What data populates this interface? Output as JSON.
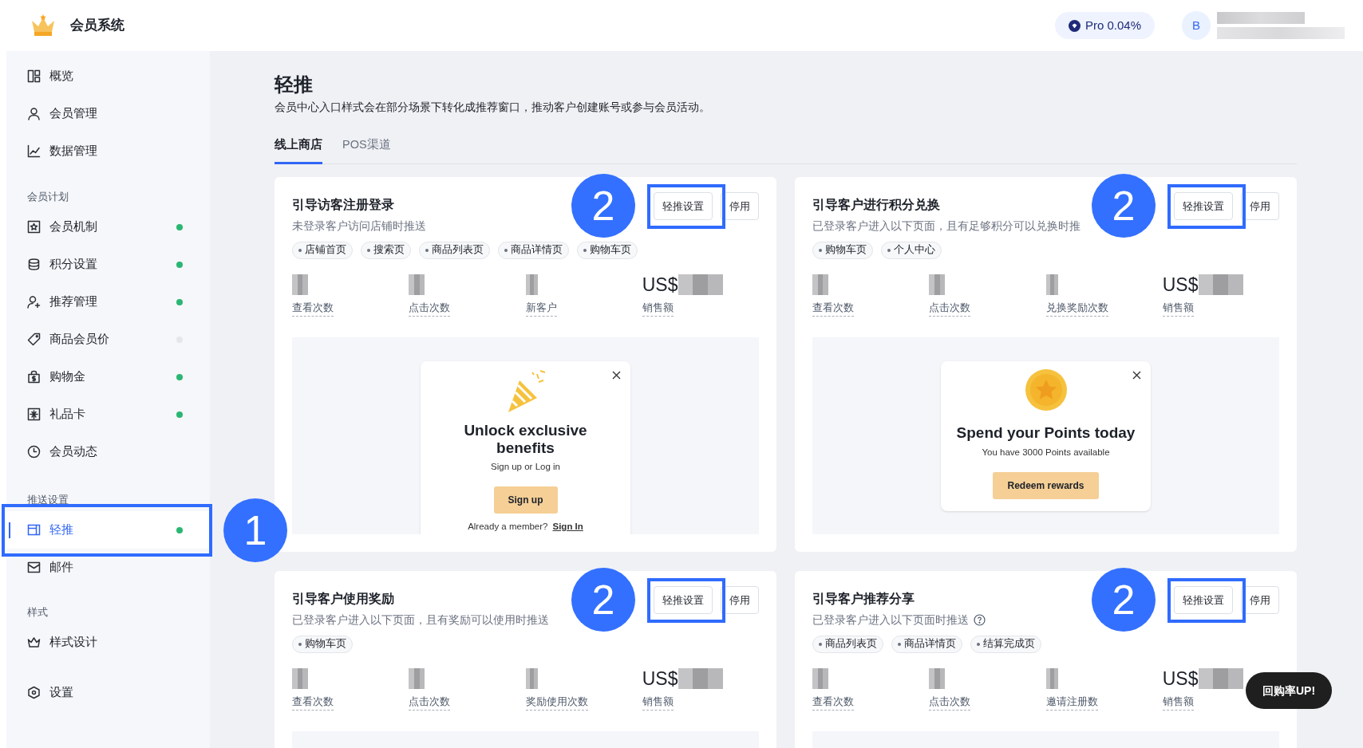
{
  "app": {
    "title": "会员系统"
  },
  "header": {
    "plan_badge": "Pro 0.04%",
    "avatar": "B"
  },
  "sidebar": {
    "sections": [
      {
        "items": [
          {
            "label": "概览",
            "selected": false
          },
          {
            "label": "会员管理",
            "selected": false
          },
          {
            "label": "数据管理",
            "selected": false
          }
        ]
      },
      {
        "heading": "会员计划",
        "items": [
          {
            "label": "会员机制",
            "selected": false,
            "color": "#2bb673"
          },
          {
            "label": "积分设置",
            "selected": false,
            "color": "#2bb673"
          },
          {
            "label": "推荐管理",
            "selected": false,
            "color": "#2bb673"
          },
          {
            "label": "商品会员价",
            "selected": false,
            "color": "#e4e6eb"
          },
          {
            "label": "购物金",
            "selected": false,
            "color": "#2bb673"
          },
          {
            "label": "礼品卡",
            "selected": false,
            "color": "#2bb673"
          },
          {
            "label": "会员动态",
            "selected": false
          }
        ]
      },
      {
        "heading": "推送设置",
        "items": [
          {
            "label": "轻推",
            "selected": true,
            "color": "#2bb673",
            "annotation": "1"
          },
          {
            "label": "邮件",
            "selected": false
          }
        ]
      },
      {
        "heading": "样式",
        "items": [
          {
            "label": "样式设计",
            "selected": false
          }
        ]
      },
      {
        "items": [
          {
            "label": "设置",
            "selected": false
          }
        ]
      }
    ]
  },
  "page": {
    "title": "轻推",
    "description": "会员中心入口样式会在部分场景下转化成推荐窗口，推动客户创建账号或参与会员活动。",
    "tabs": [
      {
        "label": "线上商店",
        "selected": true
      },
      {
        "label": "POS渠道",
        "selected": false
      }
    ],
    "cards": [
      {
        "title": "引导访客注册登录",
        "description": "未登录客户访问店铺时推送",
        "tags": [
          "店铺首页",
          "搜索页",
          "商品列表页",
          "商品详情页",
          "购物车页"
        ],
        "stats": [
          {
            "label": "查看次数"
          },
          {
            "label": "点击次数"
          },
          {
            "label": "新客户"
          },
          {
            "prefix": "US$",
            "label": "销售额"
          }
        ],
        "buttons": [
          "轻推设置",
          "停用"
        ],
        "annotation": "2",
        "preview": {
          "kind": "signup",
          "title": "Unlock exclusive benefits",
          "subtitle": "Sign up or Log in",
          "button": "Sign up",
          "footer": "Already a member?",
          "link": "Sign In"
        }
      },
      {
        "title": "引导客户进行积分兑换",
        "description": "已登录客户进入以下页面，且有足够积分可以兑换时推",
        "tags": [
          "购物车页",
          "个人中心"
        ],
        "stats": [
          {
            "label": "查看次数"
          },
          {
            "label": "点击次数"
          },
          {
            "label": "兑换奖励次数"
          },
          {
            "prefix": "US$",
            "label": "销售额"
          }
        ],
        "buttons": [
          "轻推设置",
          "停用"
        ],
        "annotation": "2",
        "preview": {
          "kind": "points",
          "title": "Spend your Points today",
          "subtitle": "You have 3000 Points available",
          "button": "Redeem rewards"
        }
      },
      {
        "title": "引导客户使用奖励",
        "description": "已登录客户进入以下页面，且有奖励可以使用时推送",
        "tags": [
          "购物车页"
        ],
        "stats": [
          {
            "label": "查看次数"
          },
          {
            "label": "点击次数"
          },
          {
            "label": "奖励使用次数"
          },
          {
            "prefix": "US$",
            "label": "销售额"
          }
        ],
        "buttons": [
          "轻推设置",
          "停用"
        ],
        "annotation": "2"
      },
      {
        "title": "引导客户推荐分享",
        "description": "已登录客户进入以下页面时推送",
        "help_icon": true,
        "tags": [
          "商品列表页",
          "商品详情页",
          "结算完成页"
        ],
        "stats": [
          {
            "label": "查看次数"
          },
          {
            "label": "点击次数"
          },
          {
            "label": "邀请注册数"
          },
          {
            "prefix": "US$",
            "label": "销售额"
          }
        ],
        "buttons": [
          "轻推设置",
          "停用"
        ],
        "annotation": "2"
      }
    ]
  },
  "floating_button": "回购率UP!"
}
